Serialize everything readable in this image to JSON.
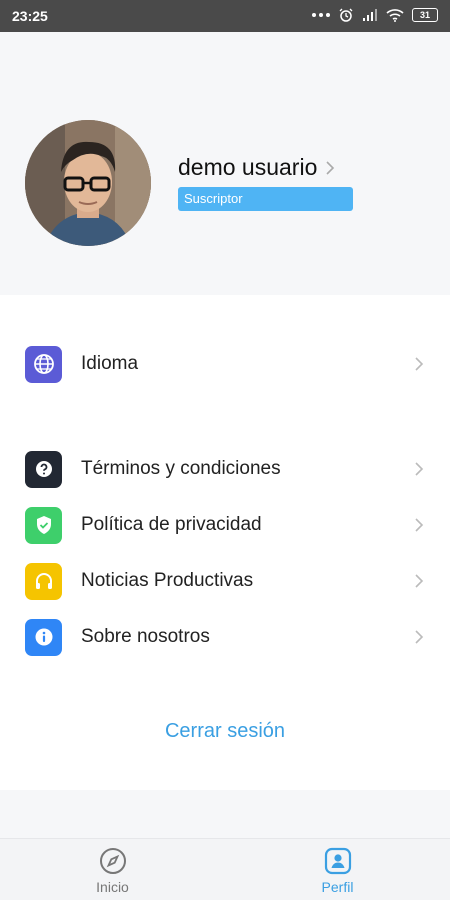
{
  "status_bar": {
    "time": "23:25",
    "battery": "31"
  },
  "profile": {
    "name": "demo usuario",
    "badge": "Suscriptor"
  },
  "menu": {
    "items": [
      {
        "label": "Idioma",
        "icon": "globe-icon",
        "color": "#5b5bd6"
      },
      {
        "label": "Términos y condiciones",
        "icon": "question-icon",
        "color": "#222833"
      },
      {
        "label": "Política de privacidad",
        "icon": "shield-icon",
        "color": "#3ecf6b"
      },
      {
        "label": "Noticias Productivas",
        "icon": "headphones-icon",
        "color": "#f5c400"
      },
      {
        "label": "Sobre nosotros",
        "icon": "info-icon",
        "color": "#2f86f6"
      }
    ],
    "logout": "Cerrar sesión"
  },
  "bottom_nav": {
    "tabs": [
      {
        "label": "Inicio",
        "icon": "compass-icon",
        "active": false
      },
      {
        "label": "Perfil",
        "icon": "profile-icon",
        "active": true
      }
    ]
  },
  "colors": {
    "accent": "#3a9fe2",
    "badge": "#4fb4f4"
  }
}
